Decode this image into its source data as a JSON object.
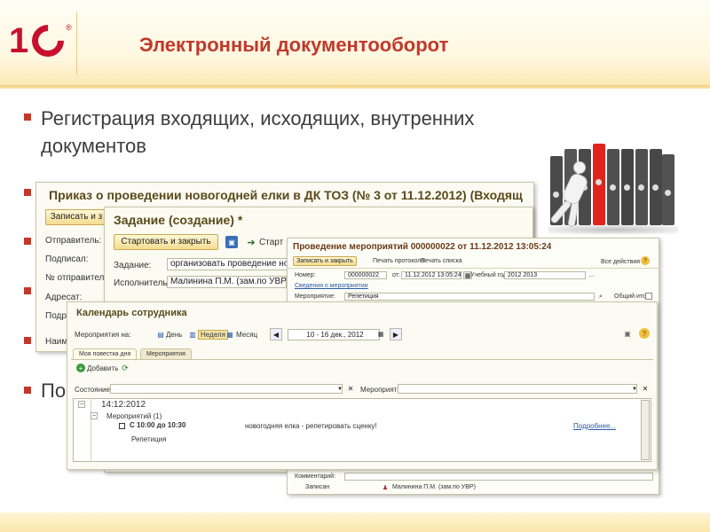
{
  "slide": {
    "title": "Электронный документооборот",
    "bullet_main": "Регистрация входящих, исходящих, внутренних документов",
    "bullet_partial": "По",
    "brand_color": "#c0392b",
    "logo_text": "1С",
    "logo_reg": "®"
  },
  "window1": {
    "title": "Приказ о проведении новогодней елки в ДК ТОЗ (№ 3 от 11.12.2012) (Входящ",
    "button_save": "Записать и з",
    "labels": [
      "Отправитель:",
      "Подписал:",
      "№ отправителя:",
      "Адресат:",
      "Подра",
      "Наим"
    ]
  },
  "window2": {
    "title": "Задание (создание) *",
    "button_start_close": "Стартовать и закрыть",
    "button_start": "Старт",
    "label_task": "Задание:",
    "task_value": "организовать проведение ново",
    "label_executor": "Исполнитель:",
    "executor_value": "Малинина П.М. (зам.по УВР)"
  },
  "window3": {
    "title": "Проведение мероприятий 000000022 от 11.12.2012 13:05:24",
    "button_save_close": "Записать и закрыть",
    "print_protocol": "Печать протокола",
    "print_list": "Печать списка",
    "all_actions": "Все действия ▾",
    "label_number": "Номер:",
    "number_value": "000000022",
    "label_from": "от:",
    "date_value": "11.12.2012 13:05:24",
    "label_year": "Учебный год:",
    "year_value": "2012 2013",
    "link_info": "Сведения о мероприятии",
    "label_event": "Мероприятие:",
    "event_value": "Репетиция",
    "label_total": "Общий итог:",
    "label_comment": "Комментарий:",
    "label_recorded": "Записан",
    "recorded_value": "Малинина П.М. (зам.по УВР)"
  },
  "window4": {
    "title": "Календарь сотрудника",
    "label_events_on": "Мероприятия на:",
    "view_day": "День",
    "view_week": "Неделя",
    "view_month": "Месяц",
    "period": "10 - 16 дек., 2012",
    "tab_agenda": "Моя повестка дня",
    "tab_events": "Мероприятия",
    "button_add": "Добавить",
    "label_state": "Состояние:",
    "label_event": "Мероприятие:",
    "time_header": "14:12:2012",
    "group_label": "Мероприятий (1)",
    "time_range": "С 10:00 до 10:30",
    "event_text": "новогодняя елка - репетировать сценку!",
    "event_name": "Репетиция",
    "details_link": "Подробнее..."
  },
  "colors": {
    "accent_red": "#c0392b",
    "binder_red": "#e0241d",
    "binder_dark": "#4a4a4a",
    "window_bg": "#fbfbf4",
    "button_yellow": "#f4dc90"
  }
}
